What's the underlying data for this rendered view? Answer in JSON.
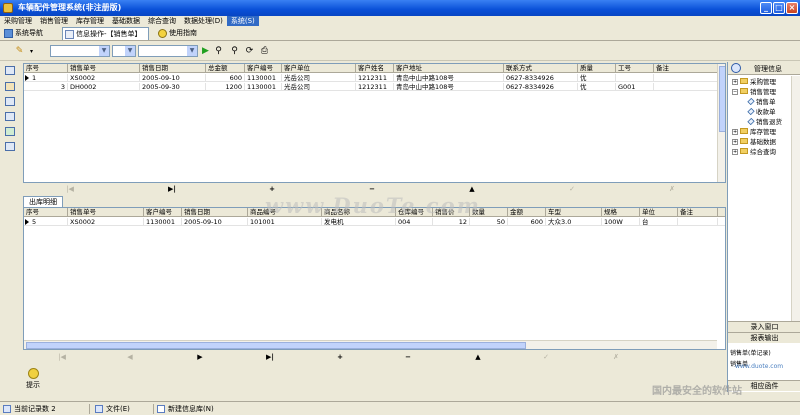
{
  "window": {
    "title": "车辆配件管理系统(非注册版)",
    "controls": [
      "_",
      "□",
      "×"
    ]
  },
  "menu": [
    "采购管理",
    "销售管理",
    "库存管理",
    "基础数据",
    "综合查询",
    "数据处理(D)",
    "系统(S)"
  ],
  "tabs": {
    "nav": "系统导航",
    "info": "信息操作-【销售单】",
    "guide": "使用指南"
  },
  "toolbar": {
    "combo1": "",
    "combo2": "",
    "combo3": ""
  },
  "master_grid": {
    "columns": [
      "序号",
      "销售单号",
      "销售日期",
      "总金额",
      "客户编号",
      "客户单位",
      "客户姓名",
      "客户地址",
      "联系方式",
      "质量",
      "工号",
      "备注"
    ],
    "rows": [
      [
        "1",
        "XS0002",
        "2005-09-10",
        "600",
        "1130001",
        "光岳公司",
        "1212311",
        "青岛中山中路108号",
        "0627-8334926",
        "优",
        "",
        ""
      ],
      [
        "3",
        "DH0002",
        "2005-09-30",
        "1200",
        "1130001",
        "光岳公司",
        "1212311",
        "青岛中山中路108号",
        "0627-8334926",
        "优",
        "G001",
        ""
      ]
    ]
  },
  "master_nav": {
    "first": "|◀",
    "last": "▶|",
    "insert": "+",
    "delete": "−",
    "edit": "▲",
    "post": "✓",
    "cancel": "✗"
  },
  "detail_tab": "出库明细",
  "detail_grid": {
    "columns": [
      "序号",
      "销售单号",
      "客户编号",
      "销售日期",
      "商品编号",
      "商品名称",
      "仓库编号",
      "销售价",
      "数量",
      "金额",
      "车型",
      "规格",
      "单位",
      "备注"
    ],
    "rows": [
      [
        "5",
        "XS0002",
        "1130001",
        "2005-09-10",
        "101001",
        "发电机",
        "004",
        "12",
        "50",
        "600",
        "大众3.0",
        "100W",
        "台",
        ""
      ]
    ]
  },
  "detail_nav": {
    "first": "|◀",
    "prior": "◀",
    "next": "▶",
    "last": "▶|",
    "insert": "+",
    "delete": "−",
    "edit": "▲",
    "post": "✓",
    "cancel": "✗"
  },
  "right_panel": {
    "title": "管理信息",
    "tree": [
      {
        "label": "采购管理",
        "level": 0,
        "expanded": false
      },
      {
        "label": "销售管理",
        "level": 0,
        "expanded": true
      },
      {
        "label": "销售单",
        "level": 1
      },
      {
        "label": "收款单",
        "level": 1
      },
      {
        "label": "销售退货",
        "level": 1
      },
      {
        "label": "库存管理",
        "level": 0,
        "expanded": false
      },
      {
        "label": "基础数据",
        "level": 0,
        "expanded": false
      },
      {
        "label": "综合查询",
        "level": 0,
        "expanded": false
      }
    ],
    "buttons": [
      "录入窗口",
      "报表输出",
      "销售单(单记录)",
      "销售单",
      "相应函件"
    ]
  },
  "prompt_label": "提示",
  "watermark": {
    "main": "www.DuoTe.com",
    "right": "国内最安全的软件站",
    "url": "www.duote.com"
  },
  "statusbar": {
    "record_count_label": "当前记录数",
    "record_count": "2",
    "file": "文件(E)",
    "new_db": "新建信息库(N)"
  },
  "colors": {
    "titlebar": "#0a50d8",
    "selection": "#316ac5",
    "face": "#ece9d8"
  }
}
